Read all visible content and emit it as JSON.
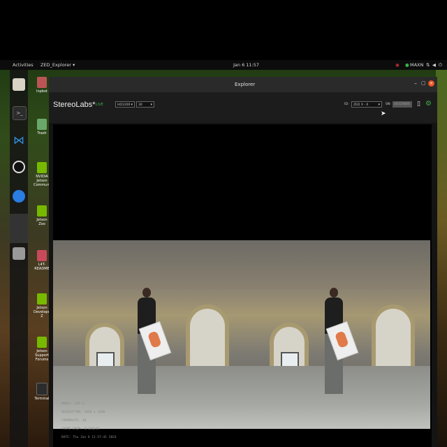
{
  "topbar": {
    "activities": "Activities",
    "app_menu": "ZED_Explorer ▾",
    "clock": "Jan 6 11:57",
    "power_mode": "MAXN"
  },
  "desktop_icons": [
    {
      "label": "Inpbot"
    },
    {
      "label": "Trash"
    },
    {
      "label": "NVIDIA Jetson Community"
    },
    {
      "label": "Jetson Zoo"
    },
    {
      "label": "L4T-README"
    },
    {
      "label": "Jetson Developer Z"
    },
    {
      "label": "Jetson Support Forums"
    },
    {
      "label": "Terminal"
    }
  ],
  "window": {
    "title": "Explorer",
    "brand": "StereoLabs*",
    "live_label": "LIVE",
    "resolution_select": "HD1200",
    "fps_select": "30",
    "id_label": "ID:",
    "id_select": "ZED X - 0",
    "sn_label": "SN:",
    "sn_value": "40320806"
  },
  "stats": {
    "model": "MODEL: ZED X",
    "resolution": "RESOLUTION: 3840 x 1200",
    "framerate": "FRAMERATE: 30",
    "frame_drop": "FRAME DROP: 0/108248",
    "date": "DATE: Thu Jan 6 11:57:41 2024"
  },
  "colors": {
    "accent_green": "#3cb043",
    "close_button": "#e95420",
    "topbar_bg": "#0c0c0c"
  }
}
